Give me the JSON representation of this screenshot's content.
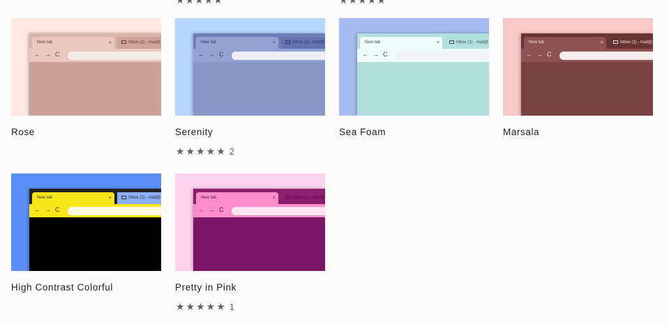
{
  "top_partial_stars": [
    "★★★★★",
    "★★★★★"
  ],
  "mini_browser": {
    "new_tab_label": "New tab",
    "inbox_tab_label": "Inbox (1) - mail@",
    "close_glyph": "×",
    "nav_glyphs": "←→C"
  },
  "themes": [
    {
      "name": "Rose",
      "rating_stars": "",
      "rating_count": "",
      "colors": {
        "bg": "#fde8e2",
        "tabstrip": "#d9b4aa",
        "active_tab": "#e8c8bf",
        "inactive_tab": "#cfa59a",
        "toolbar": "#e8c8bf",
        "omnibox": "#f5ece9",
        "content": "#c9a196",
        "text": "#5a3a33"
      }
    },
    {
      "name": "Serenity",
      "rating_stars": "★★★★★",
      "rating_count": "2",
      "colors": {
        "bg": "#b7d6fb",
        "tabstrip": "#6e7fb8",
        "active_tab": "#94a1d3",
        "inactive_tab": "#6374b0",
        "toolbar": "#94a1d3",
        "omnibox": "#eef0f8",
        "content": "#8796c6",
        "text": "#2d3566"
      }
    },
    {
      "name": "Sea Foam",
      "rating_stars": "",
      "rating_count": "",
      "colors": {
        "bg": "#a6bbf0",
        "tabstrip": "#b3dfdc",
        "active_tab": "#eefcfb",
        "inactive_tab": "#b3dfdc",
        "toolbar": "#eefcfb",
        "omnibox": "#f4f4f8",
        "content": "#b2dedc",
        "text": "#3a4a55"
      }
    },
    {
      "name": "Marsala",
      "rating_stars": "",
      "rating_count": "",
      "colors": {
        "bg": "#f8c9c9",
        "tabstrip": "#6a3434",
        "active_tab": "#8f5252",
        "inactive_tab": "#6a3434",
        "toolbar": "#8f5252",
        "omnibox": "#f4eeee",
        "content": "#7a4343",
        "text": "#f2dede"
      }
    },
    {
      "name": "High Contrast Colorful",
      "rating_stars": "",
      "rating_count": "",
      "colors": {
        "bg": "#5b8ef6",
        "tabstrip": "#222222",
        "active_tab": "#fbe51d",
        "inactive_tab": "#8aaef7",
        "toolbar": "#fbe51d",
        "omnibox": "#fffbe3",
        "content": "#000000",
        "text": "#333333"
      }
    },
    {
      "name": "Pretty in Pink",
      "rating_stars": "★★★★★",
      "rating_count": "1",
      "colors": {
        "bg": "#fdd3ee",
        "tabstrip": "#8c1e6e",
        "active_tab": "#fb8ec9",
        "inactive_tab": "#8c1e6e",
        "toolbar": "#fb8ec9",
        "omnibox": "#fde5f3",
        "content": "#7b1766",
        "text": "#5b0f47"
      }
    }
  ]
}
